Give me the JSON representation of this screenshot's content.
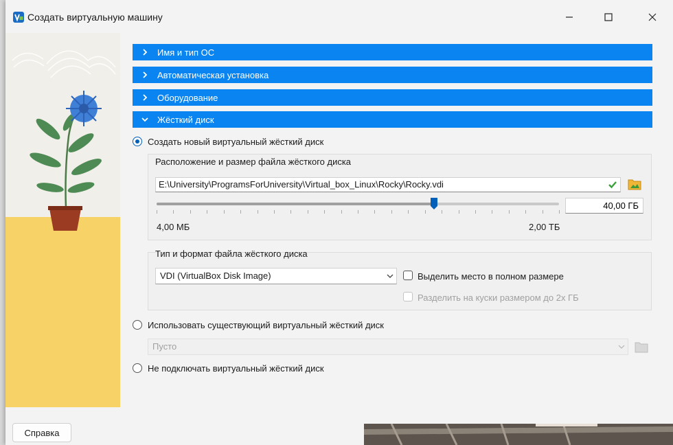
{
  "window": {
    "title": "Создать виртуальную машину",
    "icon": "virtualbox-app-icon"
  },
  "sections": [
    {
      "label": "Имя и тип ОС",
      "expanded": false
    },
    {
      "label": "Автоматическая установка",
      "expanded": false
    },
    {
      "label": "Оборудование",
      "expanded": false
    },
    {
      "label": "Жёсткий диск",
      "expanded": true
    }
  ],
  "disk": {
    "option_create": "Создать новый виртуальный жёсткий диск",
    "location_group_title": "Расположение и размер файла жёсткого диска",
    "file_path": "E:\\University\\ProgramsForUniversity\\Virtual_box_Linux\\Rocky\\Rocky.vdi",
    "size_value": "40,00 ГБ",
    "slider_min_label": "4,00 МБ",
    "slider_max_label": "2,00 ТБ",
    "slider_fraction": 0.69,
    "format_group_title": "Тип и формат файла жёсткого диска",
    "format_selected": "VDI (VirtualBox Disk Image)",
    "preallocate_label": "Выделить место в полном размере",
    "split_label": "Разделить на куски размером до 2х ГБ",
    "option_existing": "Использовать существующий виртуальный жёсткий диск",
    "existing_selected": "Пусто",
    "option_none": "Не подключать виртуальный жёсткий диск"
  },
  "footer": {
    "help_label": "Справка"
  },
  "colors": {
    "section_bar": "#0a84f0",
    "accent": "#005fb8"
  }
}
